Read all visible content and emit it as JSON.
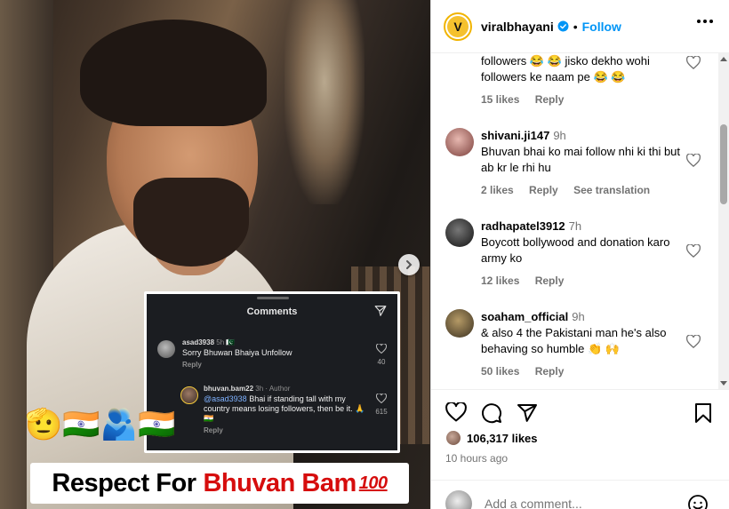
{
  "post": {
    "username": "viralbhayani",
    "logo_letter": "V",
    "follow_label": "Follow",
    "separator": "•"
  },
  "media": {
    "inset": {
      "title": "Comments",
      "c1": {
        "user": "asad3938",
        "meta": "5h 🇵🇰",
        "text": "Sorry Bhuwan Bhaiya Unfollow",
        "reply": "Reply",
        "likes": "40"
      },
      "c2": {
        "user": "bhuvan.bam22",
        "meta": "3h · Author",
        "mention": "@asad3938",
        "text": "Bhai if standing tall with my country means losing followers, then be it. 🙏🇮🇳",
        "reply": "Reply",
        "likes": "615"
      }
    },
    "emojis": "🫡🇮🇳🫂🇮🇳",
    "banner_prefix": "Respect For",
    "banner_name": "Bhuvan Bam",
    "banner_suffix": "100"
  },
  "comments": [
    {
      "user": "",
      "time": "",
      "text": "followers 😂 😂 jisko dekho wohi followers ke naam pe 😂 😂",
      "likes": "15 likes",
      "reply": "Reply",
      "translate": ""
    },
    {
      "user": "shivani.ji147",
      "time": "9h",
      "text": "Bhuvan bhai ko mai follow nhi ki thi but ab kr le rhi hu",
      "likes": "2 likes",
      "reply": "Reply",
      "translate": "See translation"
    },
    {
      "user": "radhapatel3912",
      "time": "7h",
      "text": "Boycott bollywood and donation karo army ko",
      "likes": "12 likes",
      "reply": "Reply",
      "translate": ""
    },
    {
      "user": "soaham_official",
      "time": "9h",
      "text": "& also 4 the Pakistani man he's also behaving so humble 👏 🙌",
      "likes": "50 likes",
      "reply": "Reply",
      "translate": ""
    }
  ],
  "stats": {
    "likes": "106,317 likes",
    "time_ago": "10 hours ago"
  },
  "composer": {
    "placeholder": "Add a comment..."
  },
  "colors": {
    "accent": "#0095f6",
    "banner_red": "#d60d0d",
    "logo_yellow": "#f5c12e"
  }
}
